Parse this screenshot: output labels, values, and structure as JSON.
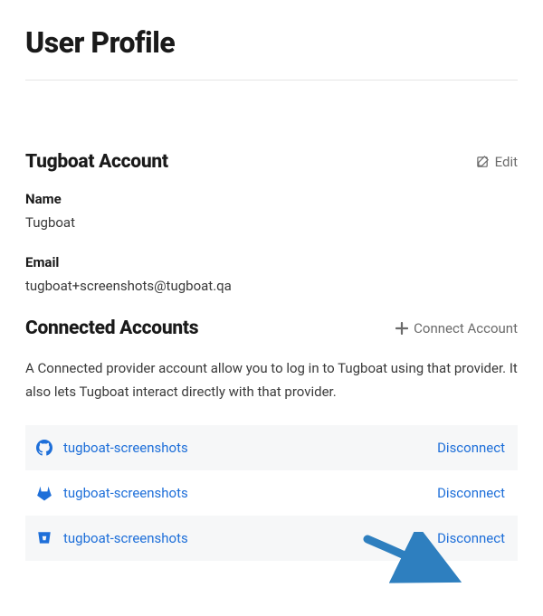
{
  "page": {
    "title": "User Profile"
  },
  "account_section": {
    "title": "Tugboat Account",
    "edit_label": "Edit",
    "fields": {
      "name_label": "Name",
      "name_value": "Tugboat",
      "email_label": "Email",
      "email_value": "tugboat+screenshots@tugboat.qa"
    }
  },
  "connected_section": {
    "title": "Connected Accounts",
    "connect_label": "Connect Account",
    "description": "A Connected provider account allow you to log in to Tugboat using that provider. It also lets Tugboat interact directly with that provider.",
    "disconnect_label": "Disconnect",
    "accounts": [
      {
        "name": "tugboat-screenshots",
        "provider": "github"
      },
      {
        "name": "tugboat-screenshots",
        "provider": "gitlab"
      },
      {
        "name": "tugboat-screenshots",
        "provider": "bitbucket"
      }
    ]
  },
  "colors": {
    "link": "#1e6fd9",
    "arrow": "#2e7fbf"
  }
}
